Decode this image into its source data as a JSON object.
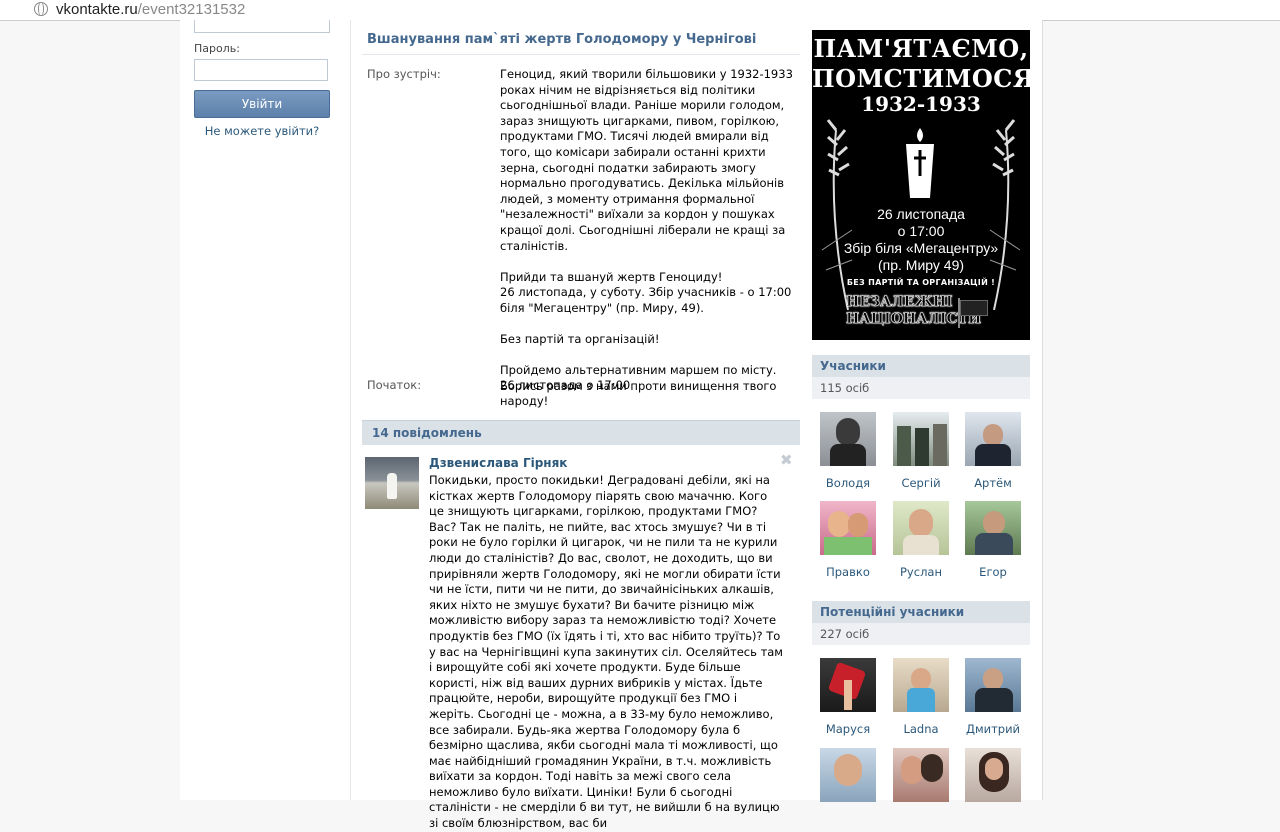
{
  "browser": {
    "url_host": "vkontakte.ru",
    "url_path": "/event32131532"
  },
  "login": {
    "password_label": "Пароль:",
    "login_button": "Увійти",
    "forgot_link": "Не можете увійти?"
  },
  "event": {
    "title": "Вшанування пам`яті жертв Голодомору у Чернігові",
    "about_label": "Про зустріч:",
    "about_paragraphs": [
      "Геноцид, який творили більшовики у 1932-1933 роках нічим не відрізняється від політики сьогоднішньої влади. Раніше морили голодом, зараз знищують цигарками, пивом, горілкою, продуктами ГМО. Тисячі людей вмирали від того, що комісари забирали останні крихти зерна, сьогодні податки забирають змогу нормально прогодуватись. Декілька мільйонів людей, з моменту отримання формальної \"незалежності\" виїхали за кордон у пошуках кращої долі. Сьогоднішні лiберали не кращі за сталіністів.",
      "Прийди та вшануй жертв Геноциду!\n26 листопада, у суботу. Збір учасників - о 17:00 біля \"Мегацентру\" (пр. Миру, 49).",
      "Без партій та організацій!",
      "Пройдемо альтернативним маршем по місту. Борись разом з нами проти винищення твого народу!"
    ],
    "start_label": "Початок:",
    "start_value": "26 листопада о 17:00"
  },
  "wall": {
    "header": "14 повідомлень",
    "post": {
      "author": "Дзвенислава Гірняк",
      "close": "✖",
      "text": "Покидьки, просто покидьки! Деградовані дебіли, які на кістках жертв Голодомору піарять свою мачачню. Кого це знищують цигарками, горілкою, продуктами ГМО? Вас? Так не паліть, не пийте, вас хтось змушує? Чи в ті роки не було горілки й цигарок, чи не пили та не курили люди до сталіністів? До вас, сволот, не доходить, що ви прирівняли жертв Голодомору, які не могли обирати їсти чи не їсти, пити чи не пити, до звичайнісіньких алкашів, яких ніхто не змушує бухати? Ви бачите різницю між можливістю вибору зараз та неможливістю тоді? Хочете продуктів без ГМО (їх їдять і ті, хто вас нібито труїть)? То у вас на Чернігівщині купа закинутих сіл. Оселяйтесь там і вирощуйте собі які хочете продукти. Буде більше користі, ніж від ваших дурних вибриків у містах. Їдьте працюйте, нероби, вирощуйте продукції без ГМО і жеріть. Сьогодні це - можна, а в 33-му було неможливо, все забирали. Будь-яка жертва Голодомору була б безмірно щаслива, якби сьогодні мала ті можливості, що має найбідніший громадянин України, в т.ч. можливість виїхати за кордон. Тоді навіть за межі свого села неможливо було виїхати. Циніки! Були б сьогодні сталіністи - не смердiли б ви тут, не вийшли б на вулицю зі своїм блюзнірством, вас би"
    }
  },
  "poster": {
    "line1": "ПАМ'ЯТАЄМО,",
    "line2": "ПОМСТИМОСЯ!",
    "year": "1932-1933",
    "date": "26 листопада",
    "time": "о 17:00",
    "place": "Збір біля «Мегацентру»",
    "address": "(пр. Миру 49)",
    "note": "БЕЗ ПАРТІЙ ТА ОРГАНІЗАЦІЙ !",
    "logo1": "НЕЗАЛЕЖНІ",
    "logo2": "НАЦІОНАЛІСТИ"
  },
  "members": {
    "header": "Учасники",
    "count": "115 осіб",
    "items": [
      {
        "name": "Володя"
      },
      {
        "name": "Сергій"
      },
      {
        "name": "Артём"
      },
      {
        "name": "Правко"
      },
      {
        "name": "Руслан"
      },
      {
        "name": "Егор"
      }
    ]
  },
  "potential": {
    "header": "Потенційні учасники",
    "count": "227 осіб",
    "items": [
      {
        "name": "Маруся"
      },
      {
        "name": "Ladna"
      },
      {
        "name": "Дмитрий"
      },
      {
        "name": ""
      },
      {
        "name": ""
      },
      {
        "name": ""
      }
    ]
  },
  "colors": {
    "link": "#2b587a",
    "header_text": "#45688e",
    "header_bg": "#dae2e8",
    "button": "#5d81ab"
  }
}
